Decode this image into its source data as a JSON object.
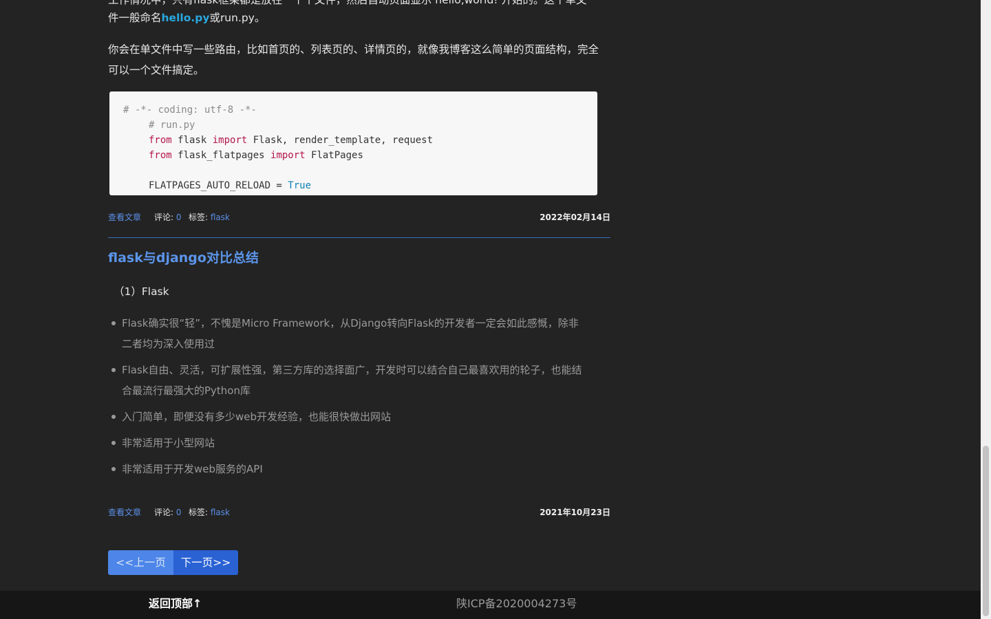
{
  "post1": {
    "intro_line_top": "工作情况中，只有flask框架都是放在一个个文件，然后自动页面显示 hello,world! 开始的。这个单文",
    "intro_line2_prefix": "件一般命名",
    "intro_link": "hello.py",
    "intro_line2_suffix": "或run.py。",
    "para2_line1": "你会在单文件中写一些路由，比如首页的、列表页的、详情页的，就像我博客这么简单的页面结构，完全",
    "para2_line2": "可以一个文件搞定。",
    "code": {
      "line1": "# -*- coding: utf-8 -*-",
      "line2": "# run.py",
      "line3_kw1": "from",
      "line3_mid": " flask ",
      "line3_kw2": "import",
      "line3_rest": " Flask, render_template, request",
      "line4_kw1": "from",
      "line4_mid": " flask_flatpages ",
      "line4_kw2": "import",
      "line4_rest": " FlatPages",
      "line6_name": "FLATPAGES_AUTO_RELOAD = ",
      "line6_value": "True"
    },
    "meta": {
      "view": "查看文章",
      "comments_label": "评论: ",
      "comments_count": "0",
      "tags_label": "标签: ",
      "tag": "flask",
      "date": "2022年02月14日"
    }
  },
  "post2": {
    "title": "flask与django对比总结",
    "subhead": "（1）Flask",
    "bullets": [
      "Flask确实很“轻”，不愧是Micro Framework，从Django转向Flask的开发者一定会如此感慨，除非",
      "二者均为深入使用过",
      "Flask自由、灵活，可扩展性强，第三方库的选择面广，开发时可以结合自己最喜欢用的轮子，也能结",
      "合最流行最强大的Python库",
      "入门简单，即便没有多少web开发经验，也能很快做出网站",
      "非常适用于小型网站",
      "非常适用于开发web服务的API"
    ],
    "meta": {
      "view": "查看文章",
      "comments_label": "评论: ",
      "comments_count": "0",
      "tags_label": "标签: ",
      "tag": "flask",
      "date": "2021年10月23日"
    }
  },
  "pager": {
    "prev": "<<上一页",
    "next": "下一页>>"
  },
  "footer": {
    "back_to_top": "返回顶部↑",
    "icp": "陕ICP备2020004273号"
  },
  "colors": {
    "background": "#232323",
    "link": "#5b8fe6",
    "accent": "#2a62d4"
  }
}
